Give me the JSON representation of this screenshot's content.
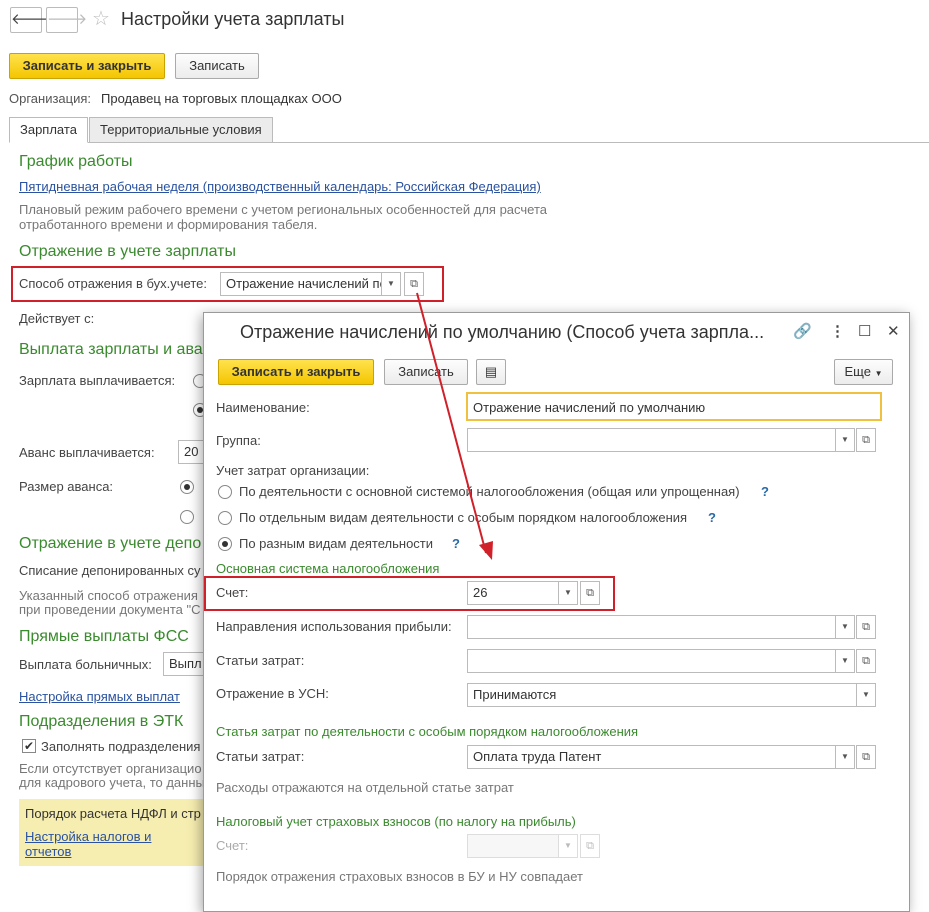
{
  "main": {
    "title": "Настройки учета зарплаты",
    "nav": {
      "back": "🡐",
      "forward": "🡒",
      "star": "☆"
    },
    "buttons": {
      "save_close": "Записать и закрыть",
      "save": "Записать"
    },
    "org_label": "Организация:",
    "org_value": "Продавец на торговых площадках ООО",
    "tabs": [
      "Зарплата",
      "Территориальные условия"
    ],
    "schedule": {
      "heading": "График работы",
      "link": "Пятидневная рабочая неделя (производственный календарь: Российская Федерация)",
      "note1": "Плановый режим рабочего времени с учетом региональных особенностей для расчета",
      "note2": "отработанного времени и формирования табеля."
    },
    "reflection": {
      "heading": "Отражение в учете зарплаты",
      "method_label": "Способ отражения в бух.учете:",
      "method_value": "Отражение начислений по умолчанию",
      "active_label": "Действует с:"
    },
    "payout": {
      "heading": "Выплата зарплаты и ава",
      "salary_label": "Зарплата выплачивается:",
      "advance_label": "Аванс выплачивается:",
      "advance_value": "20",
      "advance_size_label": "Размер аванса:"
    },
    "deposit": {
      "heading": "Отражение в учете депо",
      "writeoff_label": "Списание депонированных су",
      "note1": "Указанный способ отражения",
      "note2": "при проведении документа \"С"
    },
    "fss": {
      "heading": "Прямые выплаты ФСС",
      "sick_label": "Выплата больничных:",
      "sick_value": "Выпл",
      "link": "Настройка прямых выплат"
    },
    "etk": {
      "heading": "Подразделения в ЭТК",
      "checkbox_label": "Заполнять подразделения",
      "note1": "Если отсутствует организацио",
      "note2": "для кадрового учета, то данны"
    },
    "ndfl": {
      "text": "Порядок расчета НДФЛ и стр",
      "link1": "Настройка налогов и",
      "link2": "отчетов"
    }
  },
  "dialog": {
    "title": "Отражение начислений по умолчанию (Способ учета зарпла...",
    "buttons": {
      "save_close": "Записать и закрыть",
      "save": "Записать",
      "more": "Еще"
    },
    "name_label": "Наименование:",
    "name_value": "Отражение начислений по умолчанию",
    "group_label": "Группа:",
    "cost_label": "Учет затрат организации:",
    "radios": [
      "По деятельности с основной системой налогообложения (общая или упрощенная)",
      "По отдельным видам деятельности с особым порядком налогообложения",
      "По разным видам деятельности"
    ],
    "help": "?",
    "main_tax": {
      "heading": "Основная система налогообложения",
      "account_label": "Счет:",
      "account_value": "26",
      "profit_label": "Направления использования прибыли:",
      "cost_items_label": "Статьи затрат:",
      "usn_label": "Отражение в УСН:",
      "usn_value": "Принимаются"
    },
    "special": {
      "heading": "Статья затрат по деятельности с особым порядком налогообложения",
      "cost_label": "Статьи затрат:",
      "cost_value": "Оплата труда Патент",
      "note": "Расходы отражаются на отдельной статье затрат"
    },
    "insurance": {
      "heading": "Налоговый учет страховых взносов (по налогу на прибыль)",
      "account_label": "Счет:",
      "note": "Порядок отражения страховых взносов в БУ и НУ совпадает"
    }
  },
  "colors": {
    "accent_green": "#3a8a2e",
    "link_blue": "#2a52a0",
    "highlight_red": "#d0202a",
    "yellow": "#f4c500"
  }
}
